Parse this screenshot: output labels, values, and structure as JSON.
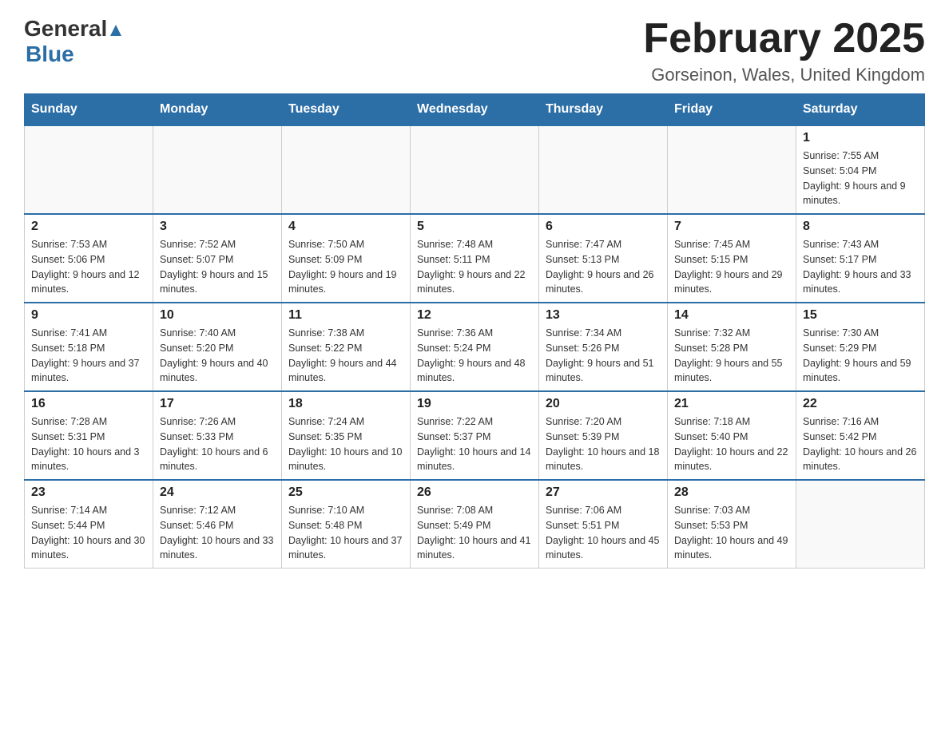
{
  "logo": {
    "general": "General",
    "blue": "Blue"
  },
  "title": "February 2025",
  "subtitle": "Gorseinon, Wales, United Kingdom",
  "headers": [
    "Sunday",
    "Monday",
    "Tuesday",
    "Wednesday",
    "Thursday",
    "Friday",
    "Saturday"
  ],
  "weeks": [
    [
      {
        "day": "",
        "info": ""
      },
      {
        "day": "",
        "info": ""
      },
      {
        "day": "",
        "info": ""
      },
      {
        "day": "",
        "info": ""
      },
      {
        "day": "",
        "info": ""
      },
      {
        "day": "",
        "info": ""
      },
      {
        "day": "1",
        "info": "Sunrise: 7:55 AM\nSunset: 5:04 PM\nDaylight: 9 hours and 9 minutes."
      }
    ],
    [
      {
        "day": "2",
        "info": "Sunrise: 7:53 AM\nSunset: 5:06 PM\nDaylight: 9 hours and 12 minutes."
      },
      {
        "day": "3",
        "info": "Sunrise: 7:52 AM\nSunset: 5:07 PM\nDaylight: 9 hours and 15 minutes."
      },
      {
        "day": "4",
        "info": "Sunrise: 7:50 AM\nSunset: 5:09 PM\nDaylight: 9 hours and 19 minutes."
      },
      {
        "day": "5",
        "info": "Sunrise: 7:48 AM\nSunset: 5:11 PM\nDaylight: 9 hours and 22 minutes."
      },
      {
        "day": "6",
        "info": "Sunrise: 7:47 AM\nSunset: 5:13 PM\nDaylight: 9 hours and 26 minutes."
      },
      {
        "day": "7",
        "info": "Sunrise: 7:45 AM\nSunset: 5:15 PM\nDaylight: 9 hours and 29 minutes."
      },
      {
        "day": "8",
        "info": "Sunrise: 7:43 AM\nSunset: 5:17 PM\nDaylight: 9 hours and 33 minutes."
      }
    ],
    [
      {
        "day": "9",
        "info": "Sunrise: 7:41 AM\nSunset: 5:18 PM\nDaylight: 9 hours and 37 minutes."
      },
      {
        "day": "10",
        "info": "Sunrise: 7:40 AM\nSunset: 5:20 PM\nDaylight: 9 hours and 40 minutes."
      },
      {
        "day": "11",
        "info": "Sunrise: 7:38 AM\nSunset: 5:22 PM\nDaylight: 9 hours and 44 minutes."
      },
      {
        "day": "12",
        "info": "Sunrise: 7:36 AM\nSunset: 5:24 PM\nDaylight: 9 hours and 48 minutes."
      },
      {
        "day": "13",
        "info": "Sunrise: 7:34 AM\nSunset: 5:26 PM\nDaylight: 9 hours and 51 minutes."
      },
      {
        "day": "14",
        "info": "Sunrise: 7:32 AM\nSunset: 5:28 PM\nDaylight: 9 hours and 55 minutes."
      },
      {
        "day": "15",
        "info": "Sunrise: 7:30 AM\nSunset: 5:29 PM\nDaylight: 9 hours and 59 minutes."
      }
    ],
    [
      {
        "day": "16",
        "info": "Sunrise: 7:28 AM\nSunset: 5:31 PM\nDaylight: 10 hours and 3 minutes."
      },
      {
        "day": "17",
        "info": "Sunrise: 7:26 AM\nSunset: 5:33 PM\nDaylight: 10 hours and 6 minutes."
      },
      {
        "day": "18",
        "info": "Sunrise: 7:24 AM\nSunset: 5:35 PM\nDaylight: 10 hours and 10 minutes."
      },
      {
        "day": "19",
        "info": "Sunrise: 7:22 AM\nSunset: 5:37 PM\nDaylight: 10 hours and 14 minutes."
      },
      {
        "day": "20",
        "info": "Sunrise: 7:20 AM\nSunset: 5:39 PM\nDaylight: 10 hours and 18 minutes."
      },
      {
        "day": "21",
        "info": "Sunrise: 7:18 AM\nSunset: 5:40 PM\nDaylight: 10 hours and 22 minutes."
      },
      {
        "day": "22",
        "info": "Sunrise: 7:16 AM\nSunset: 5:42 PM\nDaylight: 10 hours and 26 minutes."
      }
    ],
    [
      {
        "day": "23",
        "info": "Sunrise: 7:14 AM\nSunset: 5:44 PM\nDaylight: 10 hours and 30 minutes."
      },
      {
        "day": "24",
        "info": "Sunrise: 7:12 AM\nSunset: 5:46 PM\nDaylight: 10 hours and 33 minutes."
      },
      {
        "day": "25",
        "info": "Sunrise: 7:10 AM\nSunset: 5:48 PM\nDaylight: 10 hours and 37 minutes."
      },
      {
        "day": "26",
        "info": "Sunrise: 7:08 AM\nSunset: 5:49 PM\nDaylight: 10 hours and 41 minutes."
      },
      {
        "day": "27",
        "info": "Sunrise: 7:06 AM\nSunset: 5:51 PM\nDaylight: 10 hours and 45 minutes."
      },
      {
        "day": "28",
        "info": "Sunrise: 7:03 AM\nSunset: 5:53 PM\nDaylight: 10 hours and 49 minutes."
      },
      {
        "day": "",
        "info": ""
      }
    ]
  ]
}
